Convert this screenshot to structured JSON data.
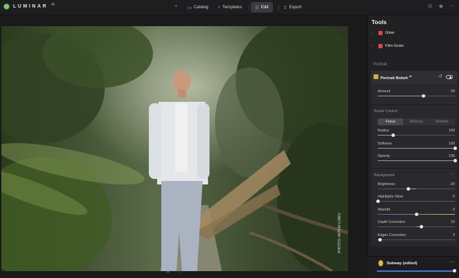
{
  "app": {
    "name": "LUMINAR",
    "version": "AI"
  },
  "nav": {
    "catalog": "Catalog",
    "templates": "Templates",
    "edit": "Edit",
    "export": "Export"
  },
  "photo": {
    "watermark": "PHOTOS: ARTEM LUNEV"
  },
  "tools": {
    "title": "Tools",
    "items": [
      {
        "label": "Glow",
        "icon": "glow-icon",
        "color": "#e2474a"
      },
      {
        "label": "Film Grain",
        "icon": "film-grain-icon",
        "color": "#e2474a"
      }
    ],
    "section": "Portrait",
    "tool_name": "Portrait Bokeh",
    "tool_badge": "AI"
  },
  "portrait_bokeh": {
    "amount": {
      "label": "Amount",
      "value": 59
    },
    "brush_control": "Brush Control",
    "modes": [
      "Focus",
      "Defocus",
      "Restore"
    ],
    "active_mode": "Focus",
    "radius": {
      "label": "Radius",
      "value": 100
    },
    "softness": {
      "label": "Softness",
      "value": 100
    },
    "opacity": {
      "label": "Opacity",
      "value": 100
    },
    "background": "Background",
    "brightness": {
      "label": "Brightness",
      "value": -20
    },
    "highlights_glow": {
      "label": "Highlights Glow",
      "value": 0
    },
    "warmth": {
      "label": "Warmth",
      "value": 0
    },
    "depth_correction": {
      "label": "Depth Correction",
      "value": 15
    },
    "edges_correction": {
      "label": "Edges Correction",
      "value": 3
    }
  },
  "preset": {
    "name": "Subway (edited)",
    "amount": 0.95
  },
  "colors": {
    "accent": "#4b74c9",
    "logo": "#7bc96f"
  }
}
